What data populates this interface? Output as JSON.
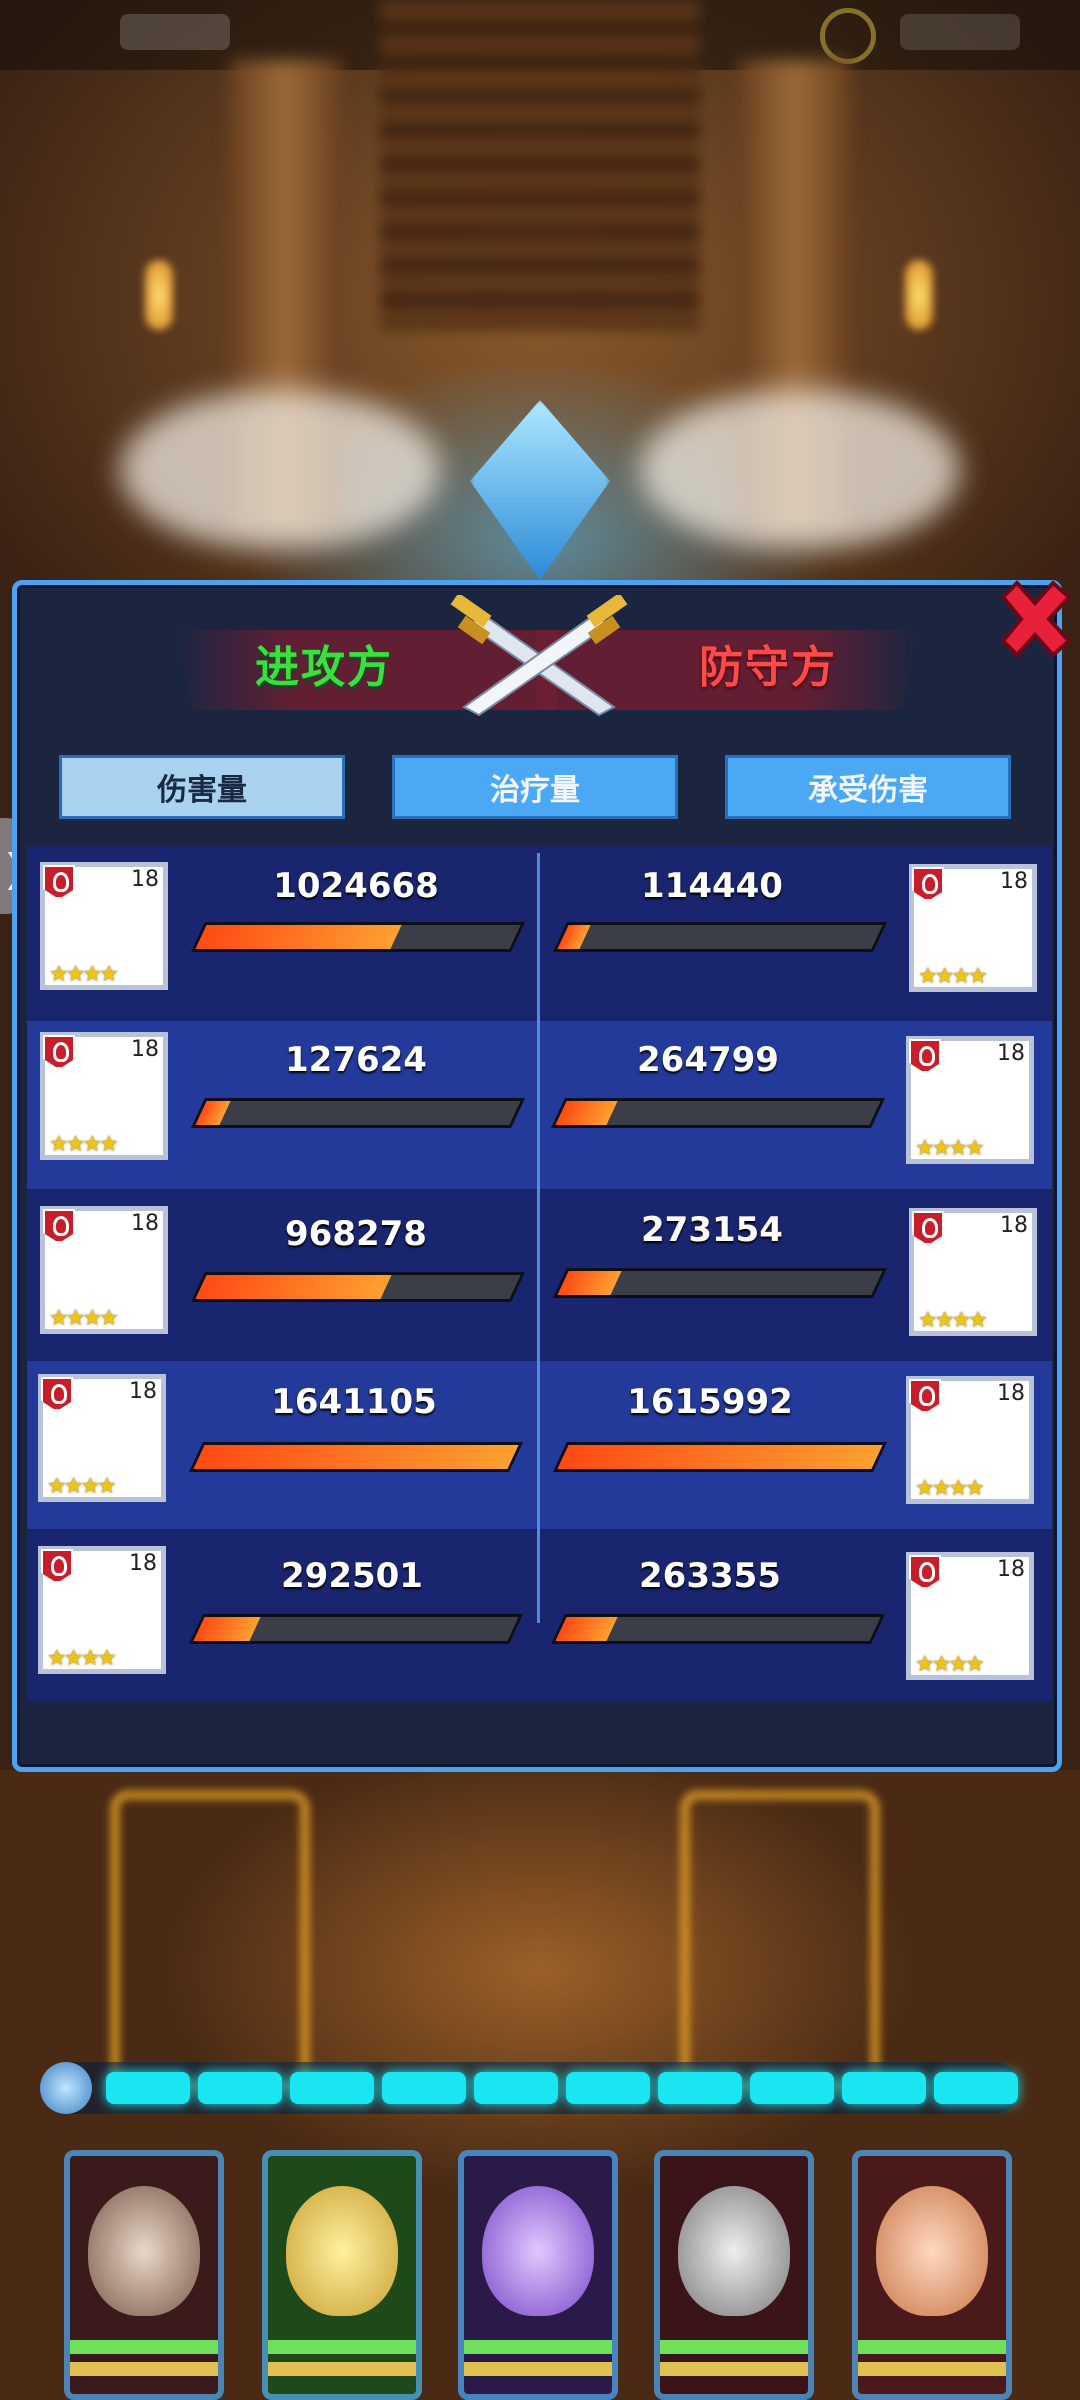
{
  "panel": {
    "attacker_label": "进攻方",
    "defender_label": "防守方",
    "tabs": [
      {
        "label": "伤害量",
        "selected": true
      },
      {
        "label": "治疗量",
        "selected": false
      },
      {
        "label": "承受伤害",
        "selected": false
      }
    ],
    "attackers": [
      {
        "level": "18",
        "stars": "★★★★",
        "value": "1024668",
        "ratio": 0.62
      },
      {
        "level": "18",
        "stars": "★★★★",
        "value": "127624",
        "ratio": 0.078
      },
      {
        "level": "18",
        "stars": "★★★★",
        "value": "968278",
        "ratio": 0.59
      },
      {
        "level": "18",
        "stars": "★★★★",
        "value": "1641105",
        "ratio": 1.0
      },
      {
        "level": "18",
        "stars": "★★★★",
        "value": "292501",
        "ratio": 0.178
      }
    ],
    "defenders": [
      {
        "level": "18",
        "stars": "★★★★",
        "value": "114440",
        "ratio": 0.071
      },
      {
        "level": "18",
        "stars": "★★★★",
        "value": "264799",
        "ratio": 0.164
      },
      {
        "level": "18",
        "stars": "★★★★",
        "value": "273154",
        "ratio": 0.169
      },
      {
        "level": "18",
        "stars": "★★★★",
        "value": "1615992",
        "ratio": 1.0
      },
      {
        "level": "18",
        "stars": "★★★★",
        "value": "263355",
        "ratio": 0.163
      }
    ]
  },
  "side_tab": {
    "icon": "chevron-right-icon",
    "glyph": "❯"
  },
  "energy_segments": 10,
  "heroes": [
    "hero-1",
    "hero-2",
    "hero-3",
    "hero-4",
    "hero-5"
  ],
  "colors": {
    "attacker": "#39e23b",
    "defender": "#ff4a4a",
    "accent": "#4aa3f0",
    "bar_fill": "#ff6a20"
  }
}
